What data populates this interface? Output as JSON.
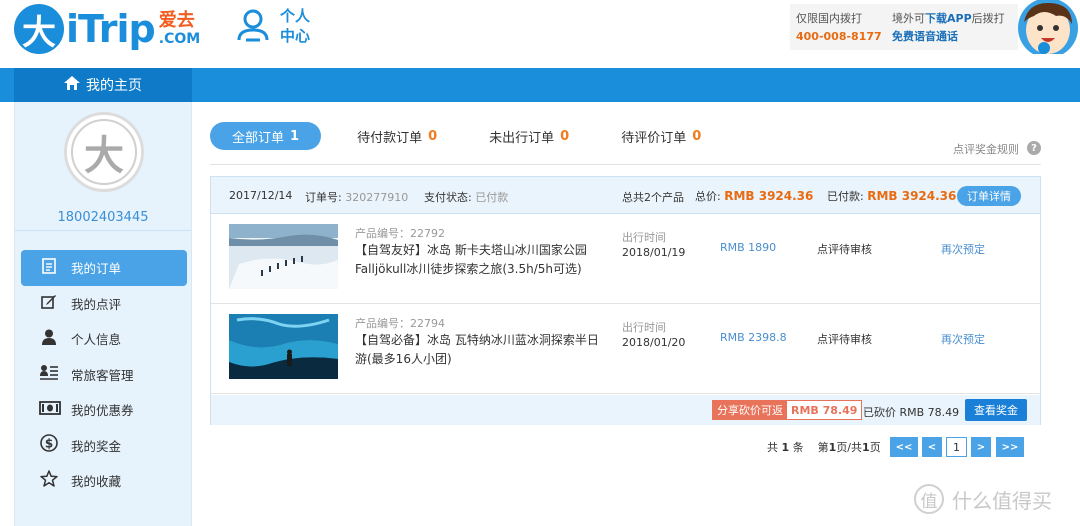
{
  "header": {
    "logo_mark": "大",
    "logo_text": "iTrip",
    "logo_cn": "爱去",
    "logo_com": ".COM",
    "personal_center": "个人中心",
    "hotline": {
      "domestic_label": "仅限国内拨打",
      "domestic_number": "400-008-8177",
      "overseas_label_pre": "境外可",
      "overseas_label_link": "下载APP",
      "overseas_label_post": "后拨打",
      "overseas_value": "免费语音通话"
    }
  },
  "nav": {
    "home_label": "我的主页"
  },
  "sidebar": {
    "avatar_mark": "大",
    "phone": "18002403445",
    "items": [
      {
        "label": "我的订单",
        "icon": "order-doc-icon",
        "active": true
      },
      {
        "label": "我的点评",
        "icon": "edit-review-icon"
      },
      {
        "label": "个人信息",
        "icon": "person-icon"
      },
      {
        "label": "常旅客管理",
        "icon": "traveler-list-icon"
      },
      {
        "label": "我的优惠券",
        "icon": "coupon-icon"
      },
      {
        "label": "我的奖金",
        "icon": "dollar-icon"
      },
      {
        "label": "我的收藏",
        "icon": "star-icon"
      }
    ]
  },
  "tabs": [
    {
      "label": "全部订单",
      "count": "1"
    },
    {
      "label": "待付款订单",
      "count": "0"
    },
    {
      "label": "未出行订单",
      "count": "0"
    },
    {
      "label": "待评价订单",
      "count": "0"
    }
  ],
  "review_rule_link": "点评奖金规则",
  "help_glyph": "?",
  "order": {
    "date": "2017/12/14",
    "order_no_label": "订单号:",
    "order_no": "320277910",
    "pay_status_label": "支付状态:",
    "pay_status": "已付款",
    "product_count": "总共2个产品",
    "total_label": "总价:",
    "total": "RMB 3924.36",
    "paid_label": "已付款:",
    "paid": "RMB 3924.36",
    "detail_button": "订单详情",
    "items": [
      {
        "code": "产品编号：22792",
        "name": "【自驾友好】冰岛 斯卡夫塔山冰川国家公园Falljökull冰川徒步探索之旅(3.5h/5h可选)",
        "date_label": "出行时间",
        "date": "2018/01/19",
        "price": "RMB 1890",
        "status": "点评待审核",
        "rebook": "再次预定"
      },
      {
        "code": "产品编号：22794",
        "name": "【自驾必备】冰岛 瓦特纳冰川蓝冰洞探索半日游(最多16人小团)",
        "date_label": "出行时间",
        "date": "2018/01/20",
        "price": "RMB 2398.8",
        "status": "点评待审核",
        "rebook": "再次预定"
      }
    ],
    "footer": {
      "share_label": "分享砍价可返",
      "share_amount": "RMB 78.49",
      "bargained": "已砍价 RMB 78.49",
      "award_button": "查看奖金"
    }
  },
  "pagination": {
    "total_pre": "共",
    "total_num": "1",
    "total_post": "条",
    "page_pre": "第",
    "page_num": "1",
    "page_mid": "页/共",
    "page_total": "1",
    "page_post": "页",
    "first": "<<",
    "prev": "<",
    "current": "1",
    "next": ">",
    "last": ">>"
  },
  "watermark": {
    "icon_glyph": "值",
    "text": "什么值得买"
  }
}
